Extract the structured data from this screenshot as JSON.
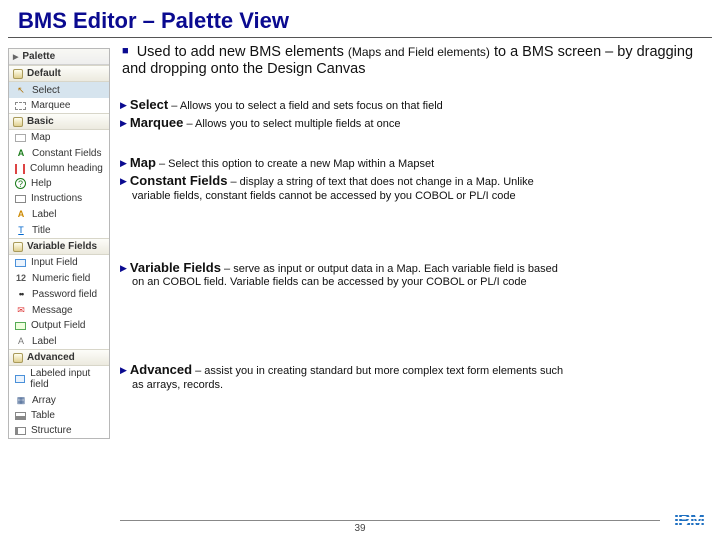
{
  "title": "BMS Editor – Palette View",
  "intro": {
    "lead": "Used to add new BMS elements ",
    "paren": "(Maps and Field elements)",
    "tail": " to a BMS screen – by dragging and dropping onto the Design Canvas"
  },
  "palette": {
    "header": "Palette",
    "sections": [
      {
        "label": "Default",
        "items": [
          {
            "label": "Select",
            "iconClass": "b-select",
            "glyph": "↖",
            "selected": true
          },
          {
            "label": "Marquee",
            "iconClass": "b-marq"
          }
        ]
      },
      {
        "label": "Basic",
        "items": [
          {
            "label": "Map",
            "iconClass": "b-map"
          },
          {
            "label": "Constant Fields",
            "iconClass": "b-const",
            "glyph": "A"
          },
          {
            "label": "Column heading",
            "iconClass": "b-col"
          },
          {
            "label": "Help",
            "iconClass": "b-help",
            "glyph": "?"
          },
          {
            "label": "Instructions",
            "iconClass": "b-inst"
          },
          {
            "label": "Label",
            "iconClass": "b-label",
            "glyph": "A"
          },
          {
            "label": "Title",
            "iconClass": "b-title",
            "glyph": "T"
          }
        ]
      },
      {
        "label": "Variable Fields",
        "items": [
          {
            "label": "Input Field",
            "iconClass": "b-inp"
          },
          {
            "label": "Numeric field",
            "iconClass": "b-num",
            "glyph": "12"
          },
          {
            "label": "Password field",
            "iconClass": "b-pwd",
            "glyph": "••"
          },
          {
            "label": "Message",
            "iconClass": "b-msg",
            "glyph": "✉"
          },
          {
            "label": "Output Field",
            "iconClass": "b-out"
          },
          {
            "label": "Label",
            "iconClass": "b-lab2",
            "glyph": "A"
          }
        ]
      },
      {
        "label": "Advanced",
        "items": [
          {
            "label": "Labeled input field",
            "iconClass": "b-inp"
          },
          {
            "label": "Array",
            "iconClass": "b-arr",
            "glyph": "▦"
          },
          {
            "label": "Table",
            "iconClass": "b-tab"
          },
          {
            "label": "Structure",
            "iconClass": "b-str"
          }
        ]
      }
    ]
  },
  "desc": {
    "select": {
      "name": "Select",
      "text": " – Allows you to select a field and sets focus on that field"
    },
    "marquee": {
      "name": "Marquee",
      "text": " – Allows you to select multiple fields at once"
    },
    "map": {
      "name": "Map",
      "text": " – Select this option to create a new Map within a Mapset"
    },
    "const": {
      "name": "Constant Fields",
      "text": " – display a string of text that does not change in a Map. Unlike",
      "cont": "variable fields, constant fields cannot be accessed by you COBOL or PL/I code"
    },
    "var": {
      "name": "Variable Fields",
      "text": " – serve as input or output data in a Map. Each variable field is based",
      "cont": "on an COBOL field.  Variable fields can be accessed by your COBOL or PL/I code"
    },
    "adv": {
      "name": "Advanced",
      "text": " – assist you in creating standard but more complex text form elements such",
      "cont": "as arrays, records."
    }
  },
  "footer": {
    "page": "39",
    "logo": "IBM"
  }
}
